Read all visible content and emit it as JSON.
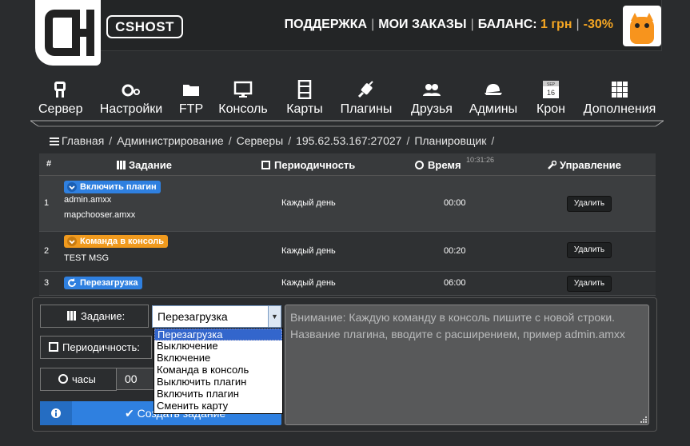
{
  "header": {
    "logo_text": "CSHOST",
    "support": "ПОДДЕРЖКА",
    "orders": "МОИ ЗАКАЗЫ",
    "balance_label": "БАЛАНС:",
    "balance_value": "1 грн",
    "discount": "-30%"
  },
  "nav": [
    {
      "label": "Сервер",
      "icon": "server-icon"
    },
    {
      "label": "Настройки",
      "icon": "settings-icon"
    },
    {
      "label": "FTP",
      "icon": "folder-icon"
    },
    {
      "label": "Консоль",
      "icon": "monitor-icon"
    },
    {
      "label": "Карты",
      "icon": "film-icon"
    },
    {
      "label": "Плагины",
      "icon": "plugin-icon"
    },
    {
      "label": "Друзья",
      "icon": "friends-icon"
    },
    {
      "label": "Админы",
      "icon": "cap-icon"
    },
    {
      "label": "Крон",
      "icon": "calendar-icon"
    },
    {
      "label": "Дополнения",
      "icon": "grid-icon"
    }
  ],
  "calendar_icon": {
    "month": "SEP",
    "day": "16"
  },
  "breadcrumb": [
    "Главная",
    "Администрирование",
    "Серверы",
    "195.62.53.167:27027",
    "Планировщик"
  ],
  "table": {
    "headers": {
      "num": "#",
      "task": "Задание",
      "period": "Периодичность",
      "time": "Время",
      "time_now": "10:31:26",
      "manage": "Управление"
    },
    "rows": [
      {
        "num": "1",
        "tag": "Включить плагин",
        "details": [
          "admin.amxx",
          "mapchooser.amxx"
        ],
        "period": "Каждый день",
        "time": "00:00",
        "action": "Удалить"
      },
      {
        "num": "2",
        "tag": "Команда в консоль",
        "details": [
          "TEST MSG"
        ],
        "period": "Каждый день",
        "time": "00:20",
        "action": "Удалить"
      },
      {
        "num": "3",
        "tag": "Перезагрузка",
        "details": [],
        "period": "Каждый день",
        "time": "06:00",
        "action": "Удалить"
      }
    ]
  },
  "form": {
    "task_label": "Задание:",
    "task_value": "Перезагрузка",
    "period_label": "Периодичность:",
    "hours_label": "часы",
    "hours_value": "00",
    "submit_label": "Создать задание",
    "options": [
      "Перезагрузка",
      "Выключение",
      "Включение",
      "Команда в консоль",
      "Выключить плагин",
      "Включить плагин",
      "Сменить карту"
    ],
    "textarea_text": [
      "Внимание: Каждую команду в консоль пишите с новой строки.",
      "Название плагина, вводите с расширением, пример admin.amxx"
    ]
  },
  "colors": {
    "accent": "#f5a623",
    "blue": "#2f80e0",
    "orange_tag": "#f09a1e"
  }
}
